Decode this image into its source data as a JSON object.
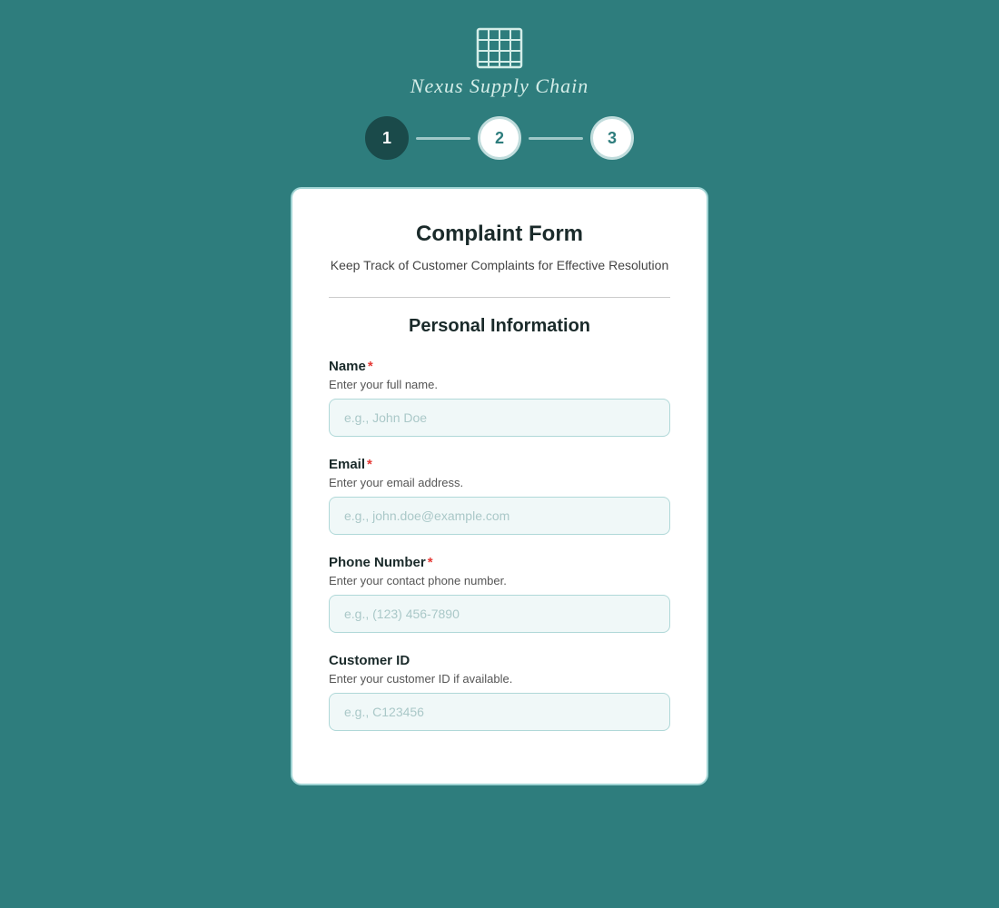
{
  "brand": {
    "name": "Nexus Supply Chain",
    "icon_label": "grid-icon"
  },
  "stepper": {
    "steps": [
      {
        "number": "1",
        "active": true
      },
      {
        "number": "2",
        "active": false
      },
      {
        "number": "3",
        "active": false
      }
    ]
  },
  "form": {
    "title": "Complaint Form",
    "subtitle": "Keep Track of Customer Complaints for Effective Resolution",
    "section_title": "Personal Information",
    "fields": [
      {
        "label": "Name",
        "required": true,
        "hint": "Enter your full name.",
        "placeholder": "e.g., John Doe",
        "type": "text",
        "name": "name-input"
      },
      {
        "label": "Email",
        "required": true,
        "hint": "Enter your email address.",
        "placeholder": "e.g., john.doe@example.com",
        "type": "email",
        "name": "email-input"
      },
      {
        "label": "Phone Number",
        "required": true,
        "hint": "Enter your contact phone number.",
        "placeholder": "e.g., (123) 456-7890",
        "type": "tel",
        "name": "phone-input"
      },
      {
        "label": "Customer ID",
        "required": false,
        "hint": "Enter your customer ID if available.",
        "placeholder": "e.g., C123456",
        "type": "text",
        "name": "customer-id-input"
      }
    ]
  },
  "colors": {
    "background": "#2e7d7d",
    "card_bg": "#ffffff",
    "accent": "#1a4a4a",
    "required": "#e53935"
  }
}
